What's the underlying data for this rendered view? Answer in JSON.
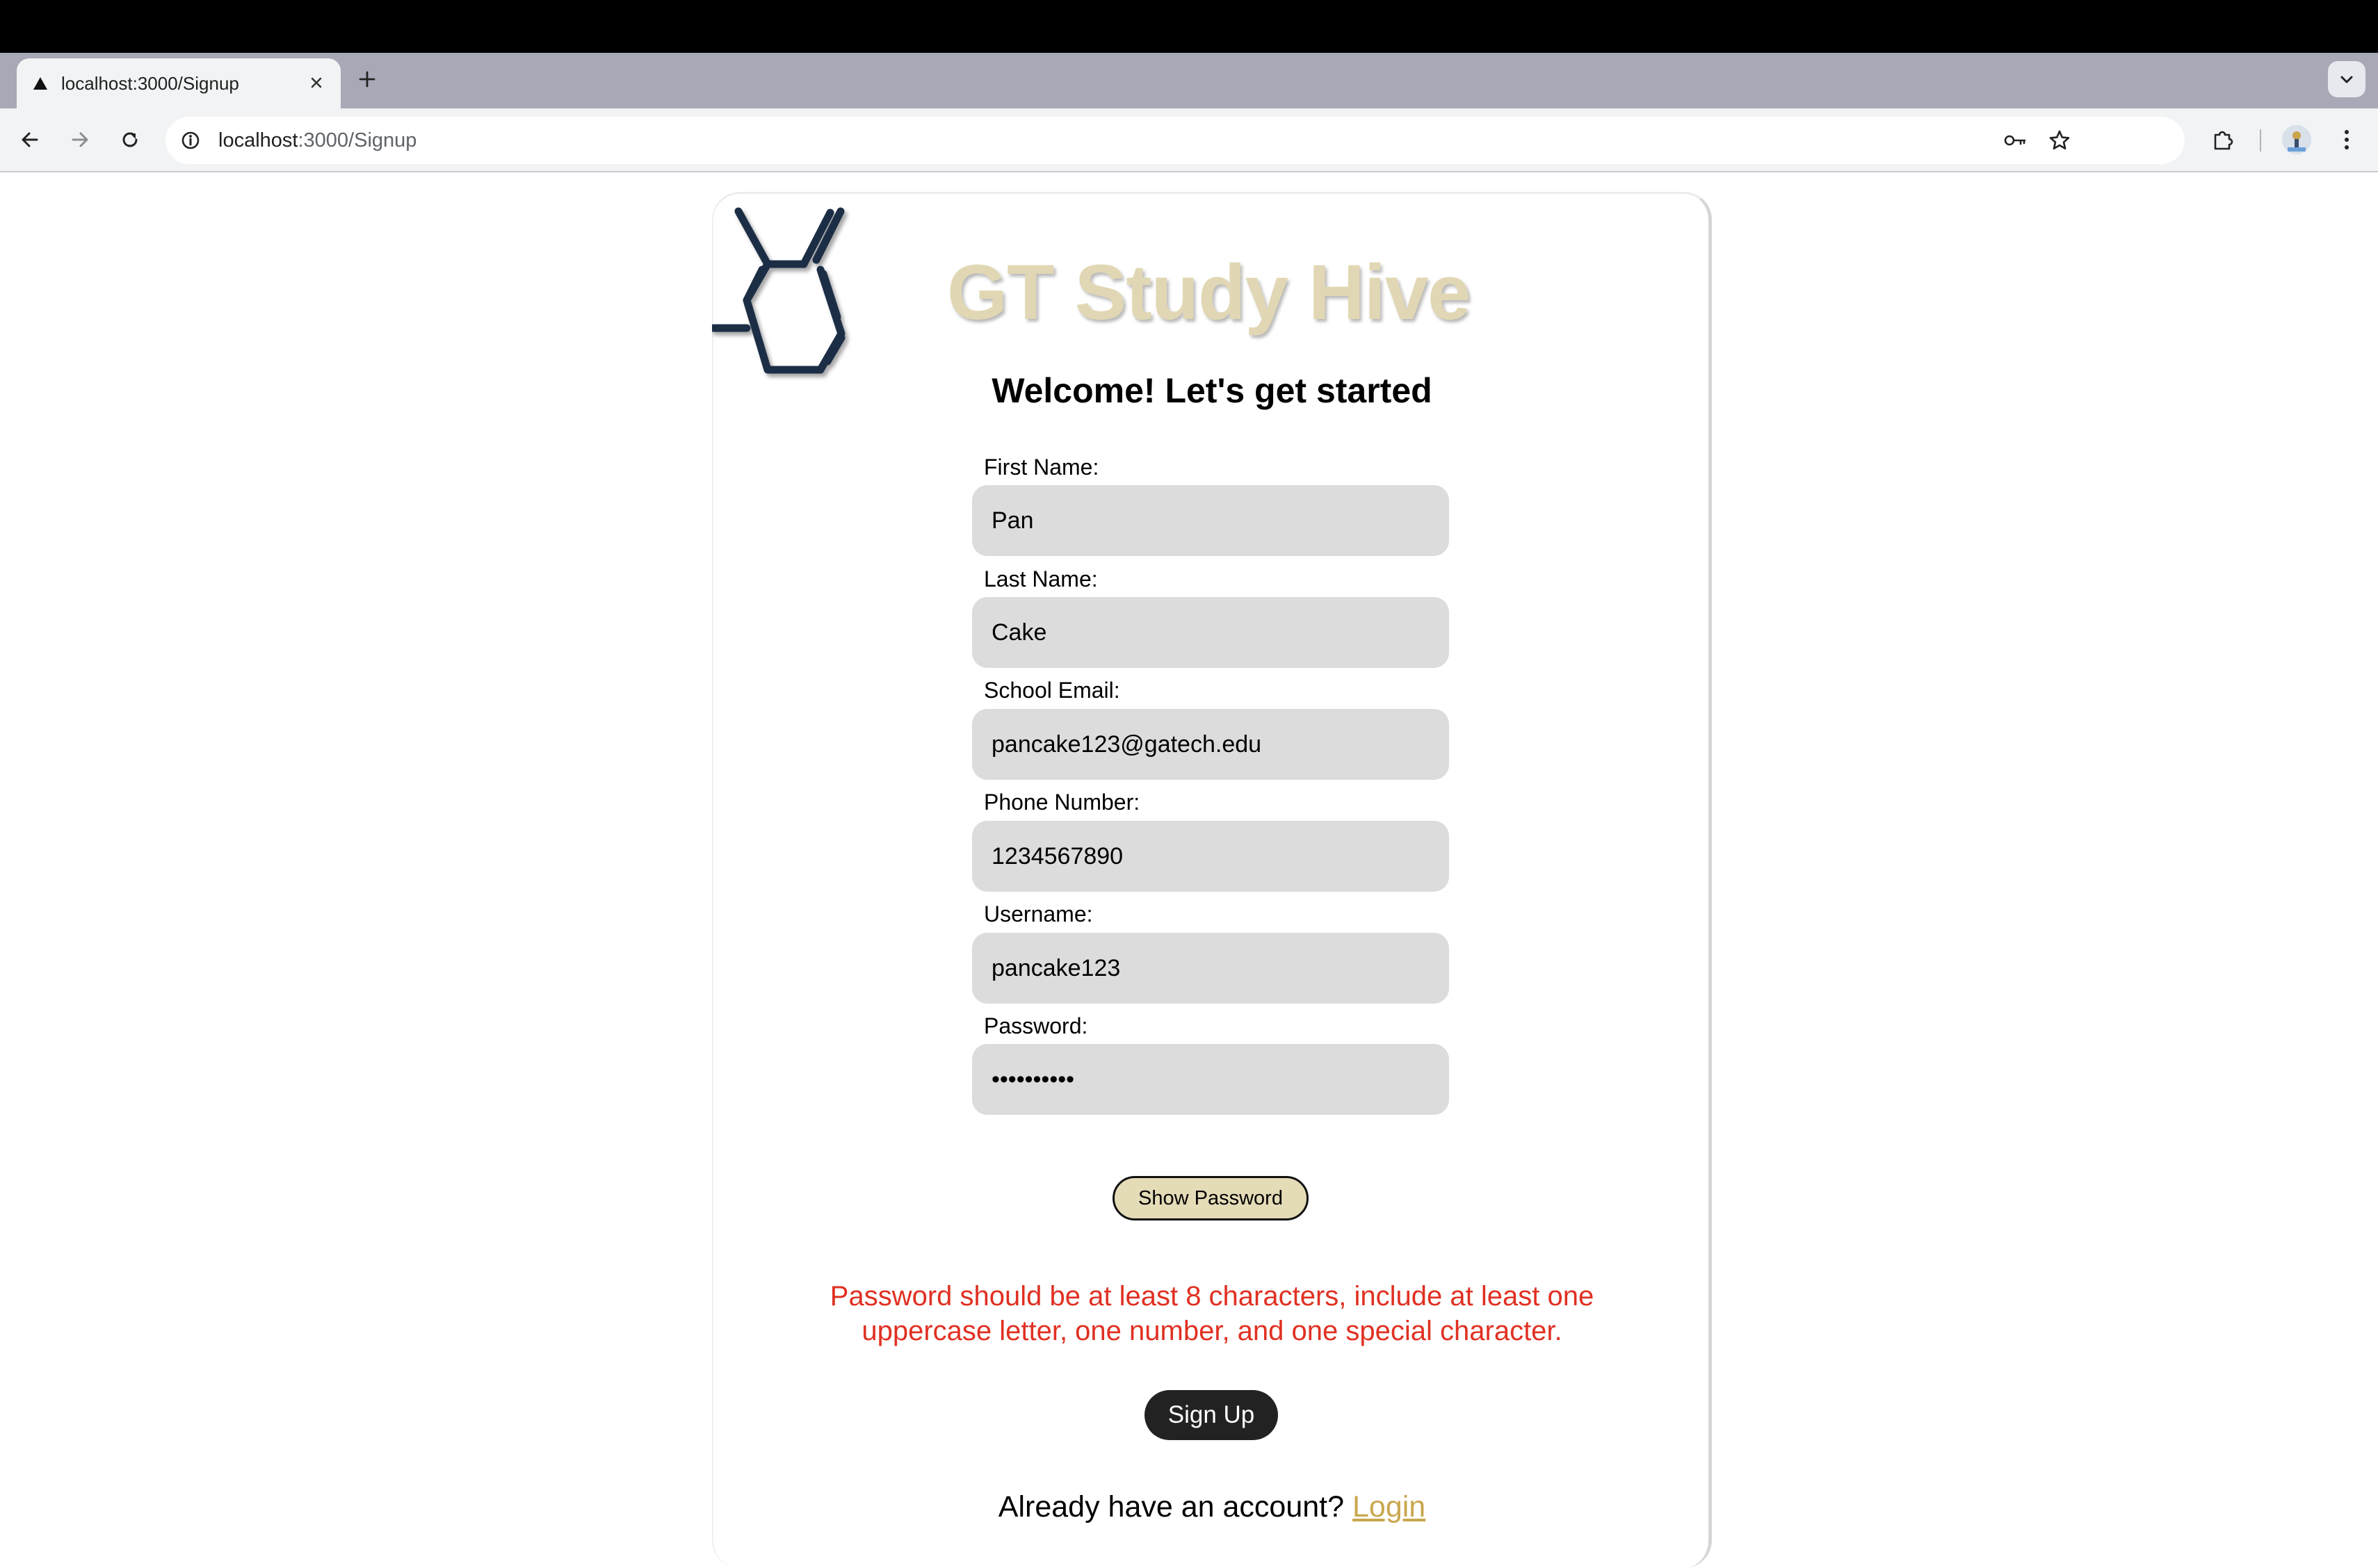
{
  "browser": {
    "tab_title": "localhost:3000/Signup",
    "url_host": "localhost",
    "url_path": ":3000/Signup"
  },
  "icons": {
    "tab_favicon": "triangle-icon",
    "tab_close": "close-icon",
    "new_tab": "plus-icon",
    "tab_search": "chevron-down-icon",
    "back": "arrow-left-icon",
    "forward": "arrow-right-icon",
    "reload": "reload-icon",
    "site_info": "info-icon",
    "passwords": "key-icon",
    "bookmark": "star-icon",
    "extensions": "puzzle-icon",
    "menu": "kebab-menu-icon",
    "logo": "hexagon-molecule-logo"
  },
  "page": {
    "site_title": "GT Study Hive",
    "welcome": "Welcome! Let's get started",
    "fields": [
      {
        "label": "First Name:",
        "value": "Pan"
      },
      {
        "label": "Last Name:",
        "value": "Cake"
      },
      {
        "label": "School Email:",
        "value": "pancake123@gatech.edu"
      },
      {
        "label": "Phone Number:",
        "value": "1234567890"
      },
      {
        "label": "Username:",
        "value": "pancake123"
      },
      {
        "label": "Password:",
        "value": "••••••••••"
      }
    ],
    "show_password_label": "Show Password",
    "error_line1": "Password should be at least 8 characters, include at least one",
    "error_line2": "uppercase letter, one number, and one special character.",
    "signup_label": "Sign Up",
    "login_prompt": "Already have an account?",
    "login_link": "Login"
  },
  "colors": {
    "title_gold": "#e1d7b4",
    "error_red": "#e03022",
    "link_gold": "#c9a74e",
    "logo_navy": "#1e2f45"
  }
}
